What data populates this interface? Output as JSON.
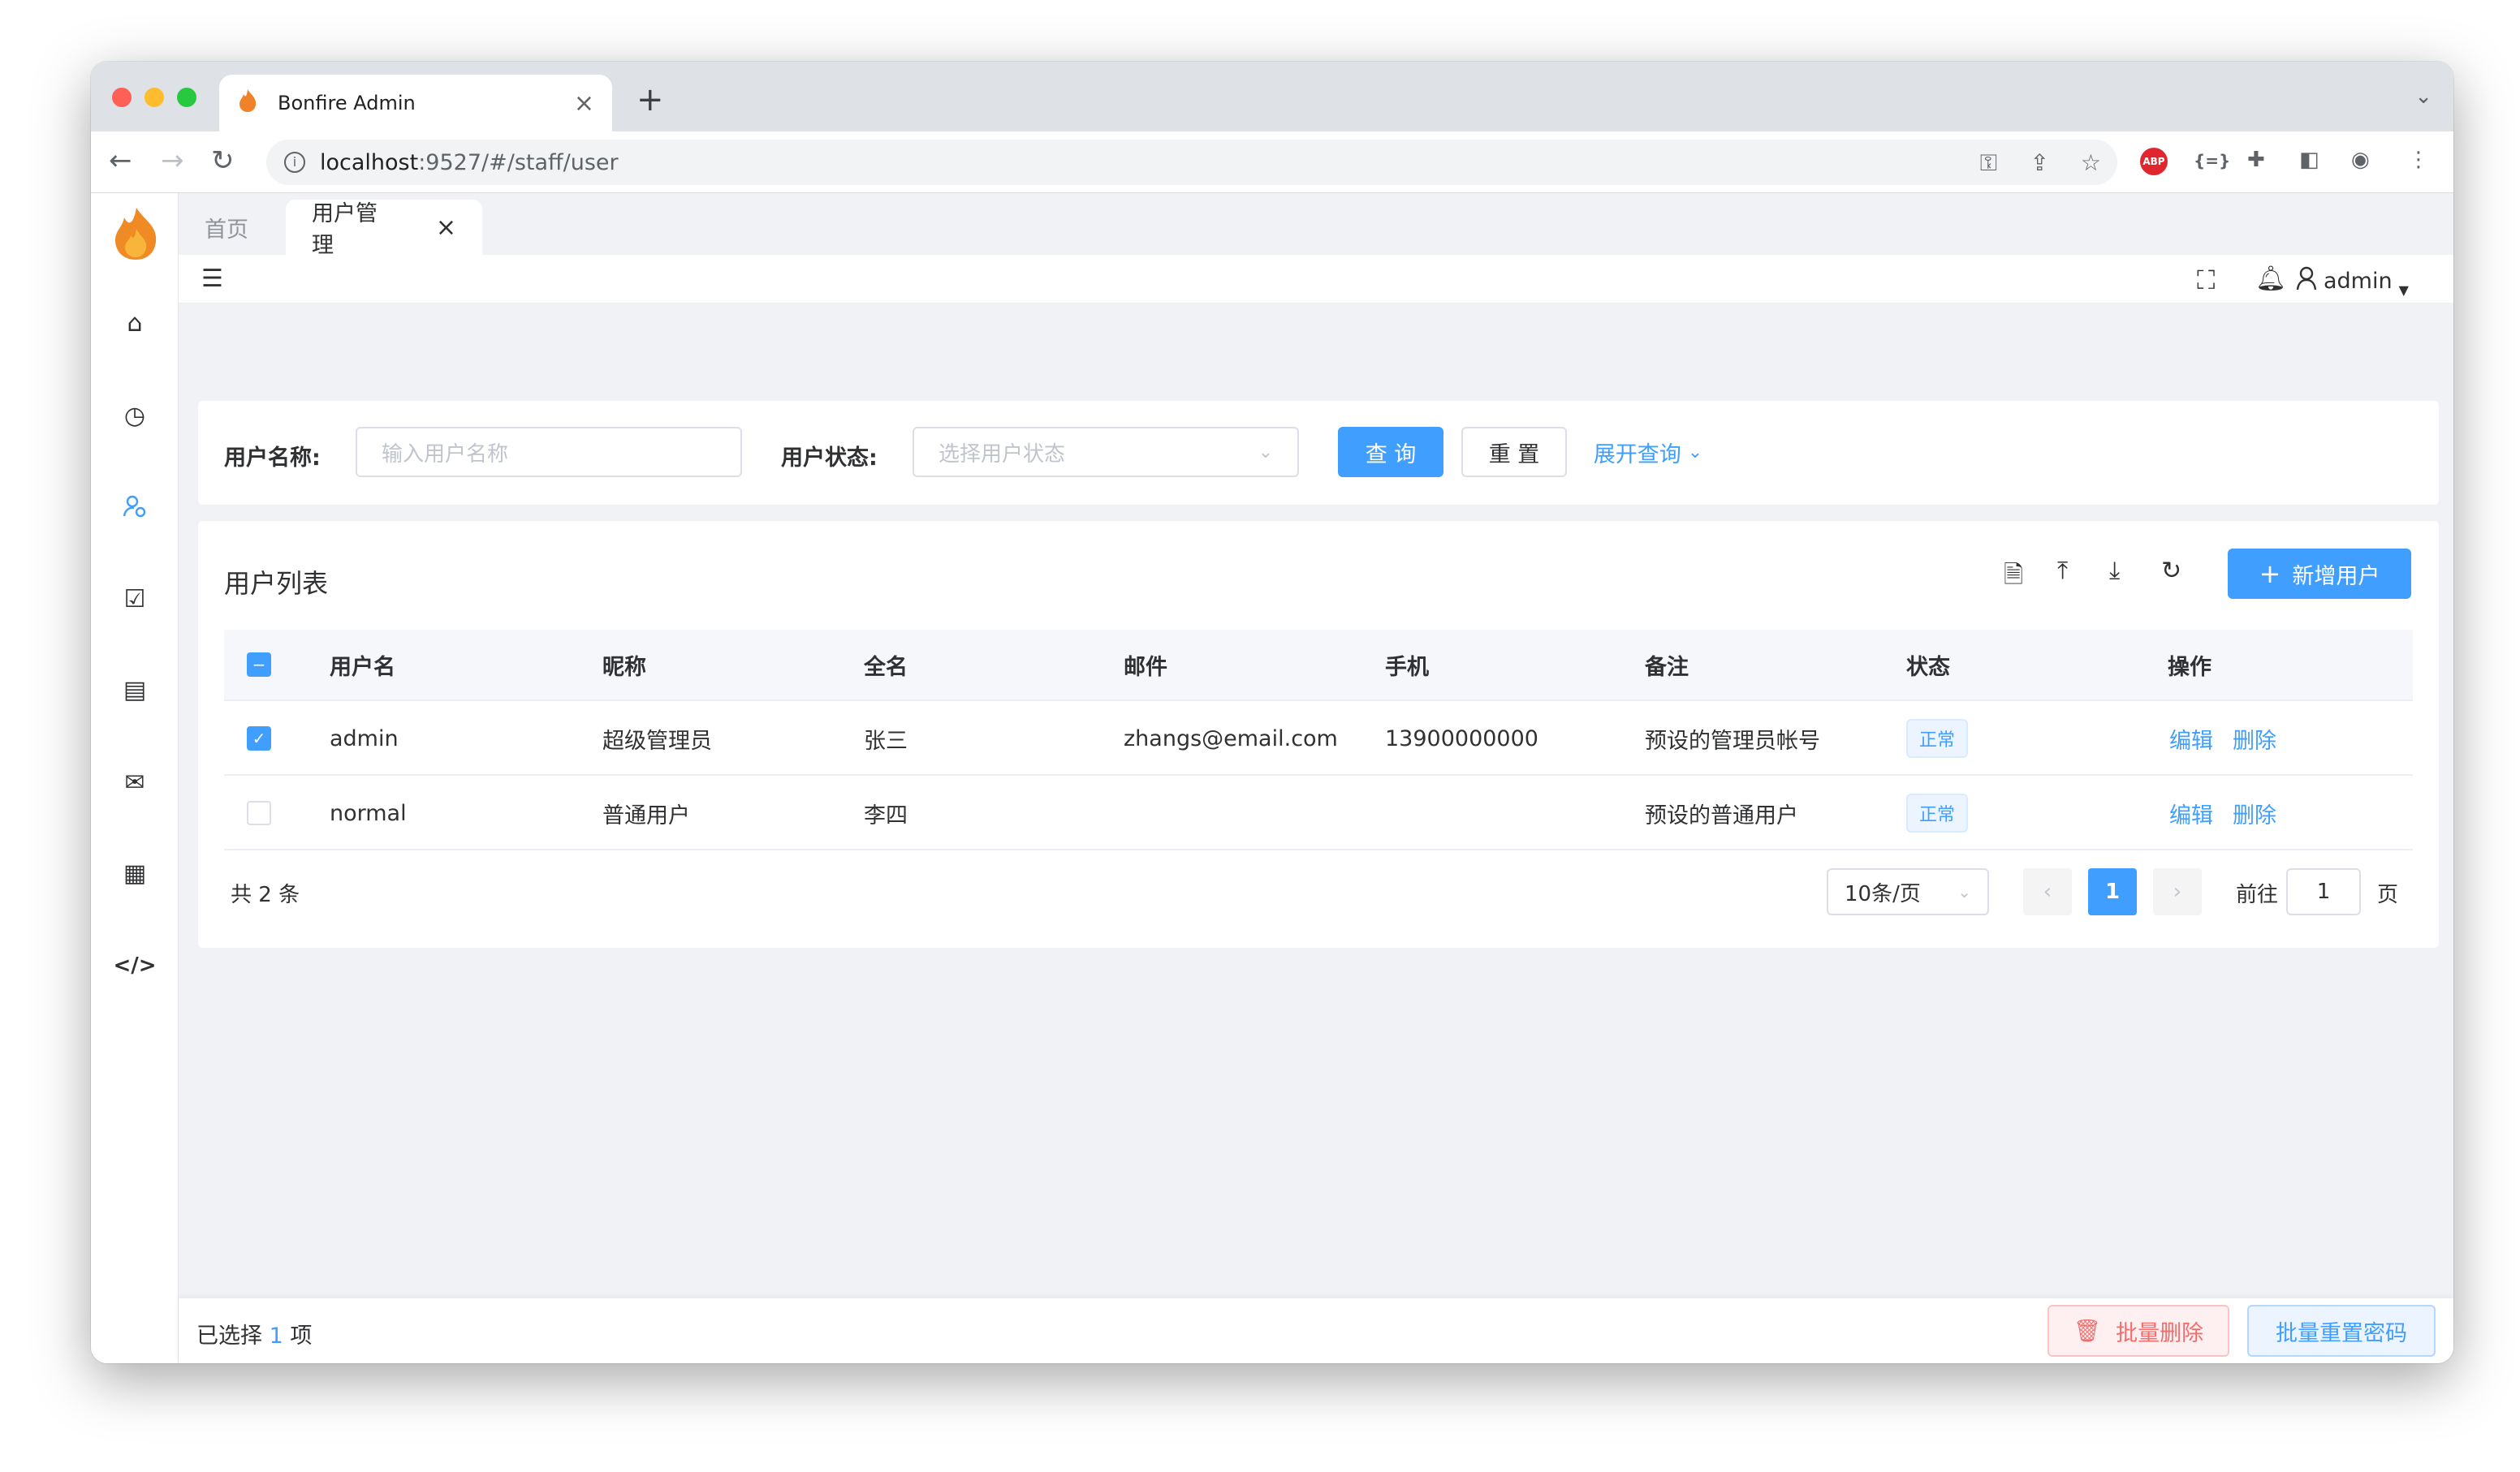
{
  "browser": {
    "tab_title": "Bonfire Admin",
    "url_host": "localhost",
    "url_rest": ":9527/#/staff/user",
    "new_tab": "+",
    "abp_label": "ABP",
    "ext_json": "{=}"
  },
  "page_tabs": [
    {
      "label": "首页"
    },
    {
      "label": "用户管理"
    }
  ],
  "navbar": {
    "username": "admin"
  },
  "search": {
    "name_label": "用户名称:",
    "name_placeholder": "输入用户名称",
    "status_label": "用户状态:",
    "status_placeholder": "选择用户状态",
    "query_button": "查 询",
    "reset_button": "重 置",
    "expand_link": "展开查询"
  },
  "list": {
    "title": "用户列表",
    "add_button": "新增用户",
    "columns": [
      "用户名",
      "昵称",
      "全名",
      "邮件",
      "手机",
      "备注",
      "状态",
      "操作"
    ],
    "rows": [
      {
        "checked": true,
        "username": "admin",
        "nickname": "超级管理员",
        "fullname": "张三",
        "email": "zhangs@email.com",
        "phone": "13900000000",
        "remark": "预设的管理员帐号",
        "status": "正常",
        "edit": "编辑",
        "delete": "删除"
      },
      {
        "checked": false,
        "username": "normal",
        "nickname": "普通用户",
        "fullname": "李四",
        "email": "",
        "phone": "",
        "remark": "预设的普通用户",
        "status": "正常",
        "edit": "编辑",
        "delete": "删除"
      }
    ]
  },
  "pagination": {
    "total": "共 2 条",
    "page_size": "10条/页",
    "current_page": "1",
    "goto_label": "前往",
    "goto_value": "1",
    "page_suffix": "页"
  },
  "footer": {
    "selected_prefix": "已选择",
    "selected_count": "1",
    "selected_suffix": "项",
    "batch_delete": "批量删除",
    "batch_reset": "批量重置密码"
  },
  "colors": {
    "primary": "#409eff",
    "danger": "#f56c6c",
    "background": "#f0f2f5"
  }
}
